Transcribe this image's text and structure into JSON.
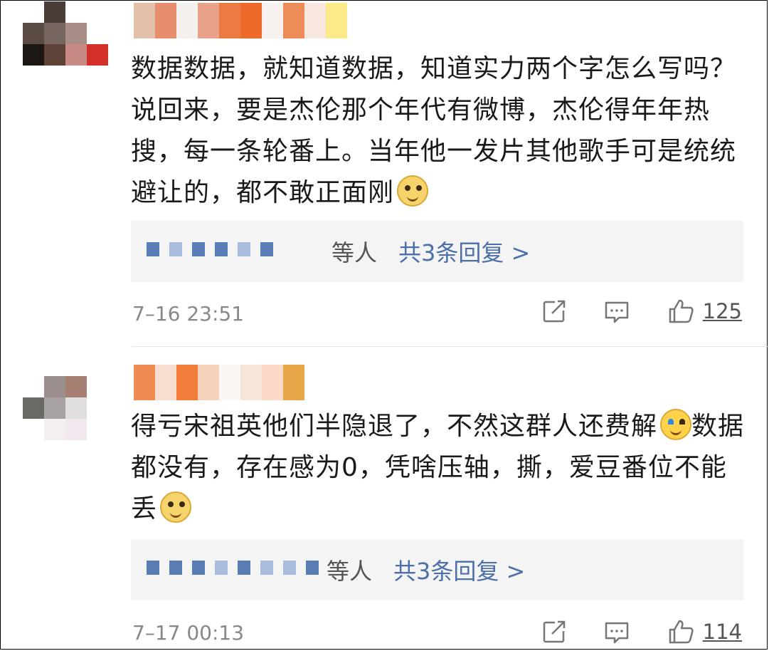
{
  "comments": [
    {
      "text": "数据数据，就知道数据，知道实力两个字怎么写吗？说回来，要是杰伦那个年代有微博，杰伦得年年热搜，每一条轮番上。当年他一发片其他歌手可是统统避让的，都不敢正面刚",
      "emoji_end": "doge-icon",
      "replies_suffix": "等人",
      "replies_link": "共3条回复 >",
      "time": "7–16 23:51",
      "likes": "125"
    },
    {
      "text_a": "得亏宋祖英他们半隐退了，不然这群人还费解",
      "emoji_mid": "laugh-cry-icon",
      "text_b": "数据都没有，存在感为0，凭啥压轴，撕，爱豆番位不能丢",
      "emoji_end": "doge-icon",
      "replies_suffix": "等人",
      "replies_link": "共3条回复 >",
      "time": "7–17 00:13",
      "likes": "114"
    }
  ],
  "icons": {
    "share": "share-icon",
    "comment": "comment-icon",
    "like": "thumbs-up-icon"
  },
  "colors": {
    "link": "#4b6fa8",
    "meta": "#888888",
    "reply_bg": "#f4f4f4"
  }
}
